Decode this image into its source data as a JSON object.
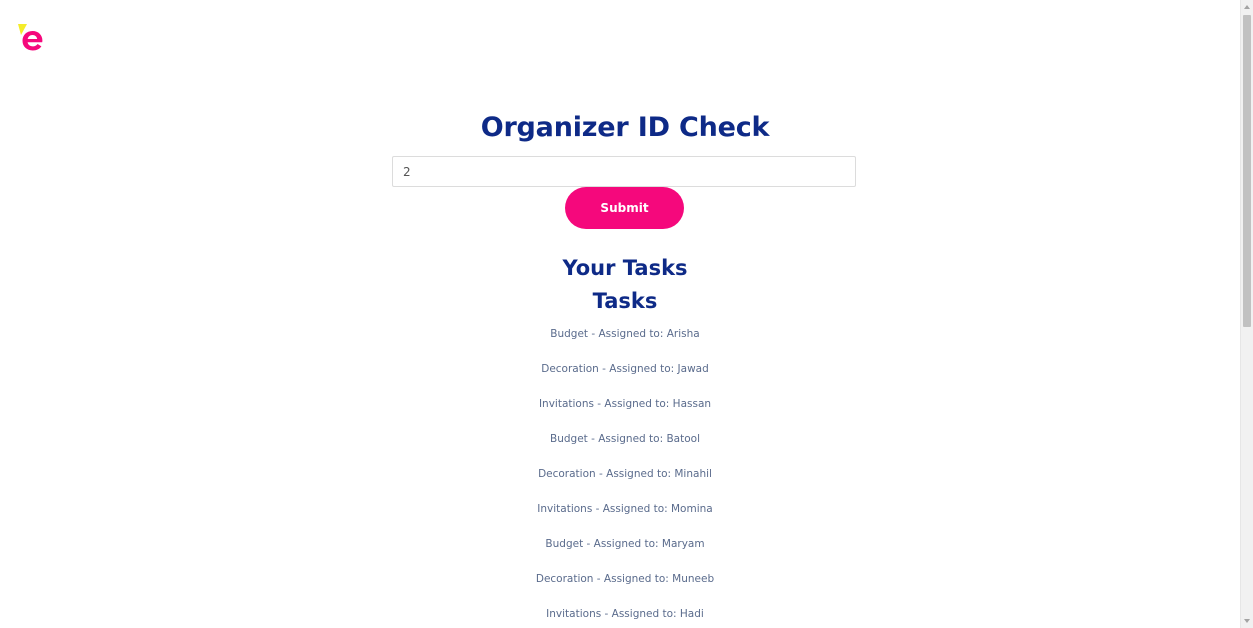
{
  "brand": {
    "logo_icon": "e-logo-icon",
    "colors": {
      "primary_pink": "#f5087c",
      "logo_yellow": "#f4ec2a",
      "heading_navy": "#0e2a87",
      "task_text": "#5a6b8c"
    }
  },
  "form": {
    "title": "Organizer ID Check",
    "id_input_value": "2",
    "submit_label": "Submit"
  },
  "tasks_section": {
    "heading": "Your Tasks",
    "subheading": "Tasks",
    "items": [
      "Budget - Assigned to: Arisha",
      "Decoration - Assigned to: Jawad",
      "Invitations - Assigned to: Hassan",
      "Budget - Assigned to: Batool",
      "Decoration - Assigned to: Minahil",
      "Invitations - Assigned to: Momina",
      "Budget - Assigned to: Maryam",
      "Decoration - Assigned to: Muneeb",
      "Invitations - Assigned to: Hadi"
    ]
  }
}
